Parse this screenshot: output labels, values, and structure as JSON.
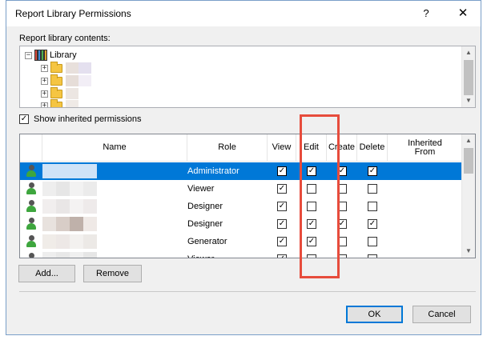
{
  "dialog": {
    "title": "Report Library Permissions",
    "help_glyph": "?",
    "close_glyph": "✕"
  },
  "contents": {
    "label": "Report library contents:",
    "root": "Library",
    "expander_glyph": "+",
    "collapse_glyph": "−"
  },
  "inherit": {
    "label": "Show inherited permissions",
    "checked": true
  },
  "grid": {
    "columns": [
      "Name",
      "Role",
      "View",
      "Edit",
      "Create",
      "Delete",
      "Inherited\nFrom"
    ],
    "rows": [
      {
        "role": "Administrator",
        "view": true,
        "edit": true,
        "create": true,
        "delete": true,
        "selected": true
      },
      {
        "role": "Viewer",
        "view": true,
        "edit": false,
        "create": false,
        "delete": false,
        "selected": false
      },
      {
        "role": "Designer",
        "view": true,
        "edit": false,
        "create": false,
        "delete": false,
        "selected": false
      },
      {
        "role": "Designer",
        "view": true,
        "edit": true,
        "create": true,
        "delete": true,
        "selected": false
      },
      {
        "role": "Generator",
        "view": true,
        "edit": true,
        "create": false,
        "delete": false,
        "selected": false
      },
      {
        "role": "Viewer",
        "view": true,
        "edit": false,
        "create": false,
        "delete": false,
        "selected": false
      }
    ]
  },
  "buttons": {
    "add": "Add...",
    "remove": "Remove",
    "ok": "OK",
    "cancel": "Cancel"
  },
  "colors": {
    "selection": "#0078d7",
    "highlight_box": "#e74c3c"
  }
}
